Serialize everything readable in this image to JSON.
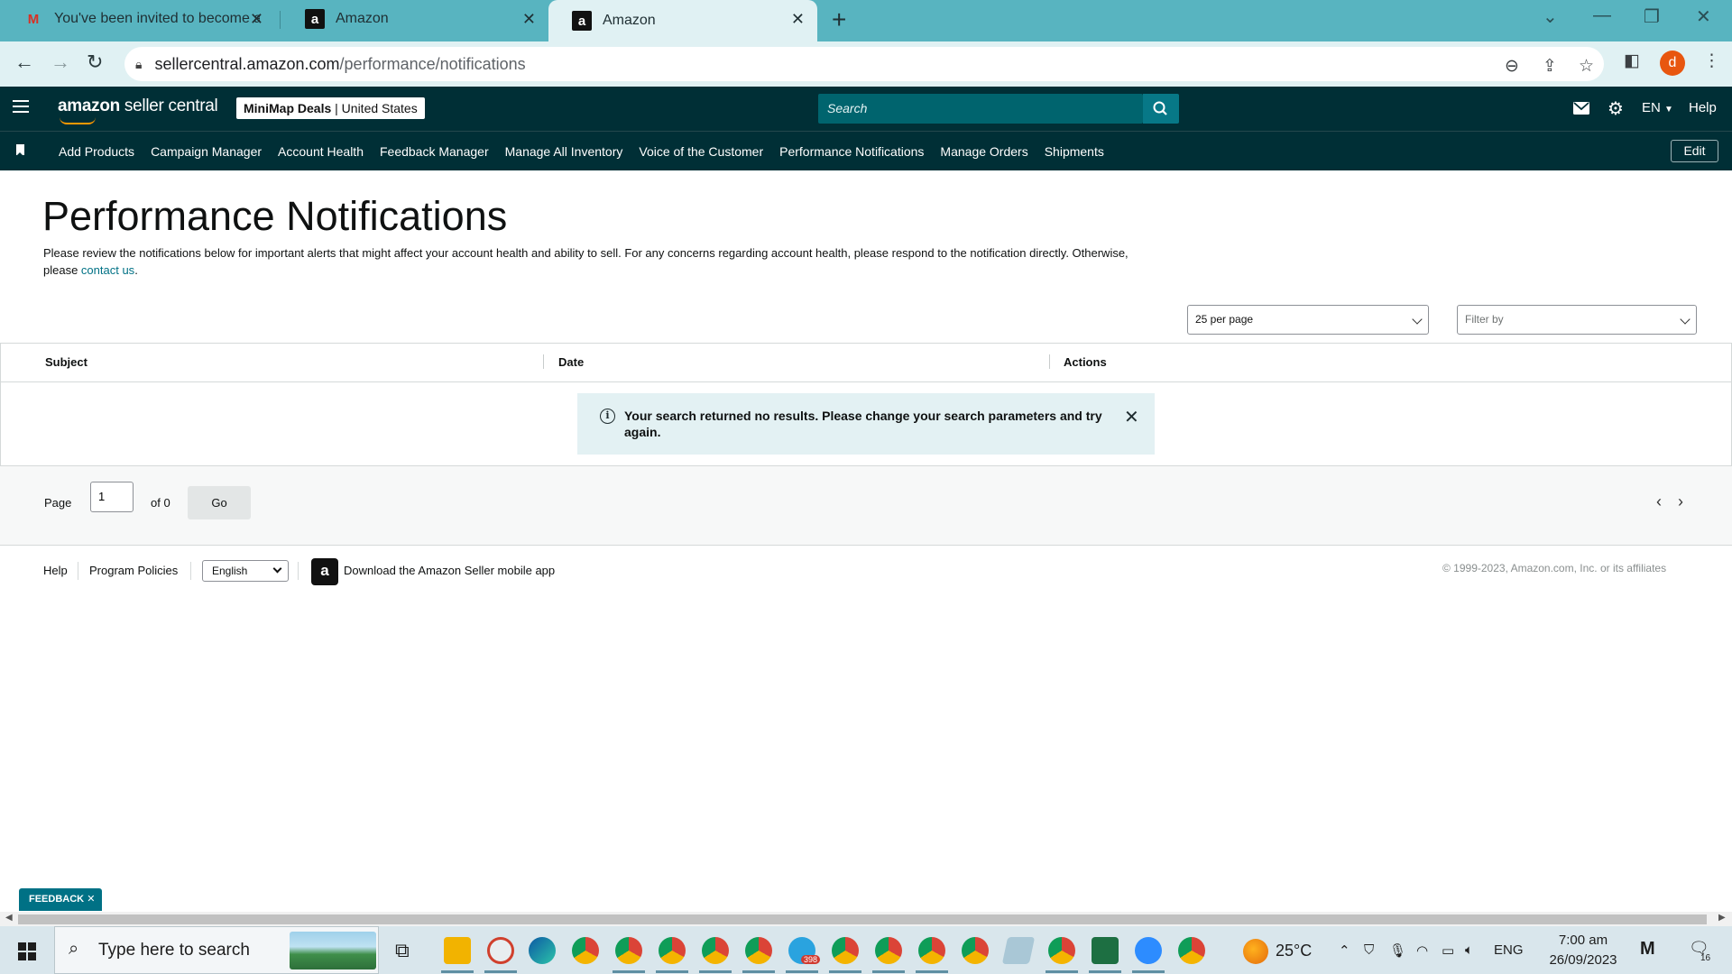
{
  "browser": {
    "tabs": [
      {
        "title": "You've been invited to become a",
        "favicon": "gmail-icon"
      },
      {
        "title": "Amazon",
        "favicon": "amazon-icon"
      },
      {
        "title": "Amazon",
        "favicon": "amazon-icon",
        "active": true
      }
    ],
    "url_host": "sellercentral.amazon.com",
    "url_path": "/performance/notifications",
    "profile_initial": "d"
  },
  "header": {
    "logo_brand": "amazon",
    "logo_suffix": " seller central",
    "store_name": "MiniMap Deals",
    "store_region": " | United States",
    "search_placeholder": "Search",
    "language": "EN",
    "help": "Help"
  },
  "nav": {
    "links": [
      "Add Products",
      "Campaign Manager",
      "Account Health",
      "Feedback Manager",
      "Manage All Inventory",
      "Voice of the Customer",
      "Performance Notifications",
      "Manage Orders",
      "Shipments"
    ],
    "edit": "Edit"
  },
  "main": {
    "title": "Performance Notifications",
    "intro_text": "Please review the notifications below for important alerts that might affect your account health and ability to sell. For any concerns regarding account health, please respond to the notification directly. Otherwise, please ",
    "intro_link": "contact us",
    "intro_end": ".",
    "per_page": "25 per page",
    "filter_placeholder": "Filter by",
    "columns": [
      "Subject",
      "Date",
      "Actions"
    ],
    "alert_message": "Your search returned no results. Please change your search parameters and try again."
  },
  "pager": {
    "page_label": "Page",
    "page_value": "1",
    "of_label": "of 0",
    "go": "Go"
  },
  "footer": {
    "help": "Help",
    "policies": "Program Policies",
    "language": "English",
    "app_text": "Download the Amazon Seller mobile app",
    "copyright": "© 1999-2023, Amazon.com, Inc. or its affiliates"
  },
  "feedback_label": "FEEDBACK",
  "taskbar": {
    "search_placeholder": "Type here to search",
    "temperature": "25°C",
    "input_lang": "ENG",
    "time": "7:00 am",
    "date": "26/09/2023",
    "telegram_badge": "398",
    "notifications": "16"
  },
  "colors": {
    "tab_bar": "#58b4c0",
    "header": "#002f36",
    "search": "#00646e",
    "link": "#007185",
    "alert_bg": "#e3f1f3"
  }
}
